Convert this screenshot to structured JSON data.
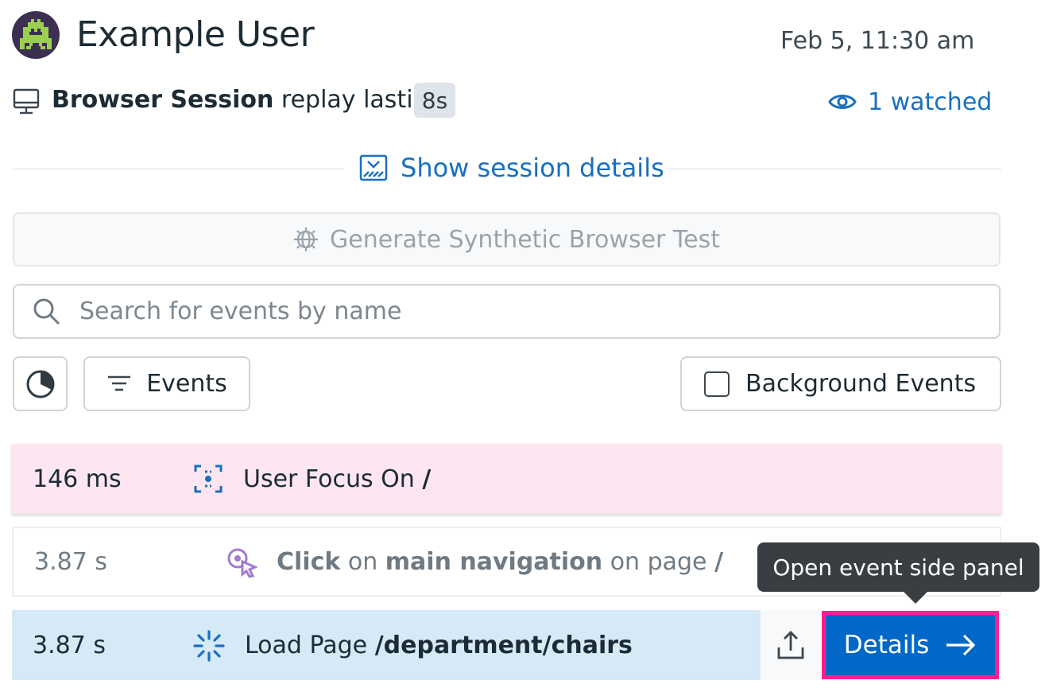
{
  "header": {
    "user_name": "Example User",
    "timestamp": "Feb 5, 11:30 am",
    "avatar_icon": "space-invader-icon"
  },
  "session": {
    "type_label": "Browser Session",
    "description": "replay lasting",
    "duration": "8s",
    "watched": "1 watched",
    "show_details": "Show session details"
  },
  "actions": {
    "generate_test": "Generate Synthetic Browser Test"
  },
  "search": {
    "placeholder": "Search for events by name",
    "value": ""
  },
  "toolbar": {
    "events_label": "Events",
    "background_events_label": "Background Events"
  },
  "events": [
    {
      "time": "146 ms",
      "action": "User Focus On",
      "target": "/"
    },
    {
      "time": "3.87 s",
      "action": "Click",
      "on": "on",
      "element": "main navigation",
      "on_page": "on page",
      "target": "/"
    },
    {
      "time": "3.87 s",
      "action": "Load Page",
      "target": "/department/chairs"
    }
  ],
  "details_button": "Details",
  "tooltip": "Open event side panel",
  "colors": {
    "link": "#1a6fbf",
    "primary": "#0168c8",
    "highlight": "#ff1f8e",
    "focus_row": "#fde6f2",
    "load_row": "#d5e9f7"
  }
}
